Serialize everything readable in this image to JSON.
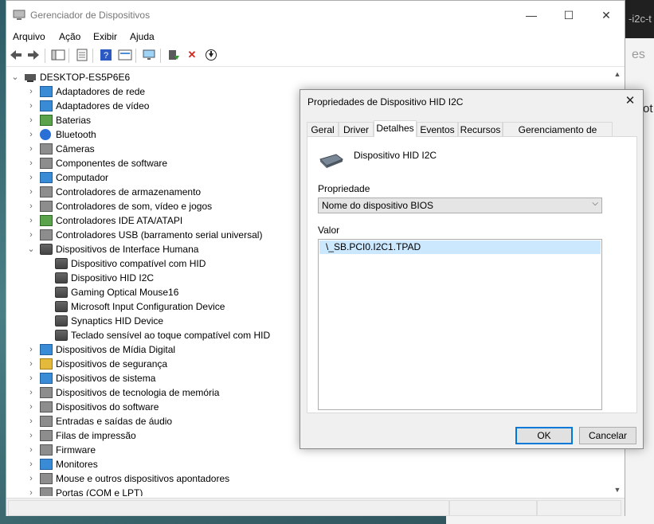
{
  "window": {
    "title": "Gerenciador de Dispositivos",
    "controls": {
      "minimize": "—",
      "maximize": "☐",
      "close": "✕"
    }
  },
  "menu": [
    "Arquivo",
    "Ação",
    "Exibir",
    "Ajuda"
  ],
  "toolbar": {
    "back": "🡐",
    "forward": "🡒",
    "help": "?",
    "remove": "✕",
    "update": "⬇"
  },
  "tree": {
    "root": "DESKTOP-ES5P6E6",
    "categories_before": [
      "Adaptadores de rede",
      "Adaptadores de vídeo",
      "Baterias",
      "Bluetooth",
      "Câmeras",
      "Componentes de software",
      "Computador",
      "Controladores de armazenamento",
      "Controladores de som, vídeo e jogos",
      "Controladores IDE ATA/ATAPI",
      "Controladores USB (barramento serial universal)"
    ],
    "expanded_category": "Dispositivos de Interface Humana",
    "hid_devices": [
      "Dispositivo compatível com HID",
      "Dispositivo HID I2C",
      "Gaming Optical Mouse16",
      "Microsoft Input Configuration Device",
      "Synaptics HID Device",
      "Teclado sensível ao toque compatível com HID"
    ],
    "categories_after": [
      "Dispositivos de Mídia Digital",
      "Dispositivos de segurança",
      "Dispositivos de sistema",
      "Dispositivos de tecnologia de memória",
      "Dispositivos do software",
      "Entradas e saídas de áudio",
      "Filas de impressão",
      "Firmware",
      "Monitores",
      "Mouse e outros dispositivos apontadores",
      "Portas (COM e LPT)"
    ]
  },
  "dialog": {
    "title": "Propriedades de Dispositivo HID I2C",
    "close": "✕",
    "tabs": [
      "Geral",
      "Driver",
      "Detalhes",
      "Eventos",
      "Recursos",
      "Gerenciamento de Energia"
    ],
    "active_tab": "Detalhes",
    "device_name": "Dispositivo HID I2C",
    "property_label": "Propriedade",
    "property_value": "Nome do dispositivo BIOS",
    "value_label": "Valor",
    "value_item": "\\_SB.PCI0.I2C1.TPAD",
    "ok": "OK",
    "cancel": "Cancelar"
  },
  "background": {
    "tab_fragment": "-i2c-t",
    "fragment2": "es",
    "fragment3": "ot"
  }
}
